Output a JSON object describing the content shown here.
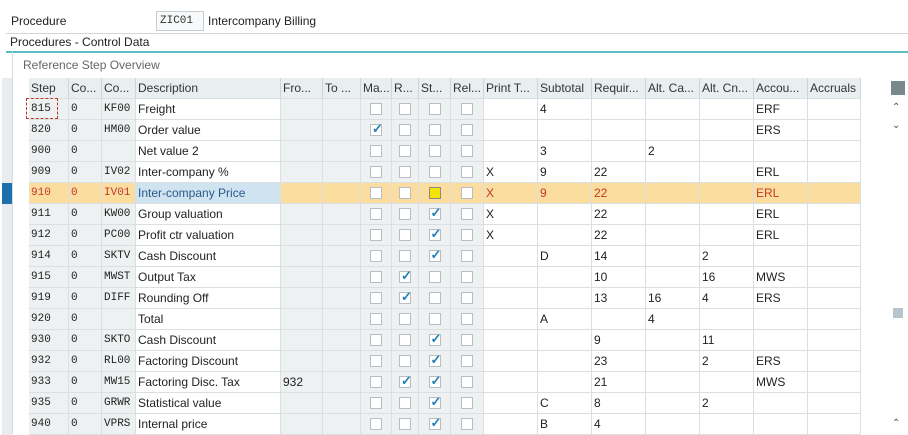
{
  "header": {
    "procedure_label": "Procedure",
    "procedure_code": "ZIC01",
    "procedure_name": "Intercompany Billing"
  },
  "group_title": "Procedures - Control Data",
  "panel_title": "Reference Step Overview",
  "columns": [
    "Step",
    "Co...",
    "Co...",
    "Description",
    "Fro...",
    "To ...",
    "Ma...",
    "R...",
    "St...",
    "Rel...",
    "Print T...",
    "Subtotal",
    "Requir...",
    "Alt. Ca...",
    "Alt. Cn...",
    "Accou...",
    "Accruals"
  ],
  "rows": [
    {
      "step": "815",
      "cnt": "0",
      "cond": "KF00",
      "desc": "Freight",
      "from": "",
      "to": "",
      "man": false,
      "req": false,
      "stat": false,
      "rel": false,
      "print": "",
      "sub": "4",
      "reqm": "",
      "altcalc": "",
      "altbase": "",
      "acct": "ERF",
      "accr": ""
    },
    {
      "step": "820",
      "cnt": "0",
      "cond": "HM00",
      "desc": "Order value",
      "from": "",
      "to": "",
      "man": true,
      "req": false,
      "stat": false,
      "rel": false,
      "print": "",
      "sub": "",
      "reqm": "",
      "altcalc": "",
      "altbase": "",
      "acct": "ERS",
      "accr": ""
    },
    {
      "step": "900",
      "cnt": "0",
      "cond": "",
      "desc": "Net value 2",
      "from": "",
      "to": "",
      "man": false,
      "req": false,
      "stat": false,
      "rel": false,
      "print": "",
      "sub": "3",
      "reqm": "",
      "altcalc": "2",
      "altbase": "",
      "acct": "",
      "accr": ""
    },
    {
      "step": "909",
      "cnt": "0",
      "cond": "IV02",
      "desc": "Inter-company %",
      "from": "",
      "to": "",
      "man": false,
      "req": false,
      "stat": false,
      "rel": false,
      "print": "X",
      "sub": "9",
      "reqm": "22",
      "altcalc": "",
      "altbase": "",
      "acct": "ERL",
      "accr": ""
    },
    {
      "step": "910",
      "cnt": "0",
      "cond": "IV01",
      "desc": "Inter-company Price",
      "from": "",
      "to": "",
      "man": false,
      "req": false,
      "stat": false,
      "rel": false,
      "print": "X",
      "sub": "9",
      "reqm": "22",
      "altcalc": "",
      "altbase": "",
      "acct": "ERL",
      "accr": ""
    },
    {
      "step": "911",
      "cnt": "0",
      "cond": "KW00",
      "desc": "Group valuation",
      "from": "",
      "to": "",
      "man": false,
      "req": false,
      "stat": true,
      "rel": false,
      "print": "X",
      "sub": "",
      "reqm": "22",
      "altcalc": "",
      "altbase": "",
      "acct": "ERL",
      "accr": ""
    },
    {
      "step": "912",
      "cnt": "0",
      "cond": "PC00",
      "desc": "Profit ctr valuation",
      "from": "",
      "to": "",
      "man": false,
      "req": false,
      "stat": true,
      "rel": false,
      "print": "X",
      "sub": "",
      "reqm": "22",
      "altcalc": "",
      "altbase": "",
      "acct": "ERL",
      "accr": ""
    },
    {
      "step": "914",
      "cnt": "0",
      "cond": "SKTV",
      "desc": "Cash Discount",
      "from": "",
      "to": "",
      "man": false,
      "req": false,
      "stat": true,
      "rel": false,
      "print": "",
      "sub": "D",
      "reqm": "14",
      "altcalc": "",
      "altbase": "2",
      "acct": "",
      "accr": ""
    },
    {
      "step": "915",
      "cnt": "0",
      "cond": "MWST",
      "desc": "Output Tax",
      "from": "",
      "to": "",
      "man": false,
      "req": true,
      "stat": false,
      "rel": false,
      "print": "",
      "sub": "",
      "reqm": "10",
      "altcalc": "",
      "altbase": "16",
      "acct": "MWS",
      "accr": ""
    },
    {
      "step": "919",
      "cnt": "0",
      "cond": "DIFF",
      "desc": "Rounding Off",
      "from": "",
      "to": "",
      "man": false,
      "req": true,
      "stat": false,
      "rel": false,
      "print": "",
      "sub": "",
      "reqm": "13",
      "altcalc": "16",
      "altbase": "4",
      "acct": "ERS",
      "accr": ""
    },
    {
      "step": "920",
      "cnt": "0",
      "cond": "",
      "desc": "Total",
      "from": "",
      "to": "",
      "man": false,
      "req": false,
      "stat": false,
      "rel": false,
      "print": "",
      "sub": "A",
      "reqm": "",
      "altcalc": "4",
      "altbase": "",
      "acct": "",
      "accr": ""
    },
    {
      "step": "930",
      "cnt": "0",
      "cond": "SKTO",
      "desc": "Cash Discount",
      "from": "",
      "to": "",
      "man": false,
      "req": false,
      "stat": true,
      "rel": false,
      "print": "",
      "sub": "",
      "reqm": "9",
      "altcalc": "",
      "altbase": "11",
      "acct": "",
      "accr": ""
    },
    {
      "step": "932",
      "cnt": "0",
      "cond": "RL00",
      "desc": "Factoring Discount",
      "from": "",
      "to": "",
      "man": false,
      "req": false,
      "stat": true,
      "rel": false,
      "print": "",
      "sub": "",
      "reqm": "23",
      "altcalc": "",
      "altbase": "2",
      "acct": "ERS",
      "accr": ""
    },
    {
      "step": "933",
      "cnt": "0",
      "cond": "MW15",
      "desc": "Factoring Disc. Tax",
      "from": "932",
      "to": "",
      "man": false,
      "req": true,
      "stat": true,
      "rel": false,
      "print": "",
      "sub": "",
      "reqm": "21",
      "altcalc": "",
      "altbase": "",
      "acct": "MWS",
      "accr": ""
    },
    {
      "step": "935",
      "cnt": "0",
      "cond": "GRWR",
      "desc": "Statistical value",
      "from": "",
      "to": "",
      "man": false,
      "req": false,
      "stat": true,
      "rel": false,
      "print": "",
      "sub": "C",
      "reqm": "8",
      "altcalc": "",
      "altbase": "2",
      "acct": "",
      "accr": ""
    },
    {
      "step": "940",
      "cnt": "0",
      "cond": "VPRS",
      "desc": "Internal price",
      "from": "",
      "to": "",
      "man": false,
      "req": false,
      "stat": true,
      "rel": false,
      "print": "",
      "sub": "B",
      "reqm": "4",
      "altcalc": "",
      "altbase": "",
      "acct": "",
      "accr": ""
    }
  ],
  "selected_row": 4,
  "icons": {
    "settings": "table-settings-icon",
    "up": "scroll-up-icon",
    "down": "scroll-down-icon"
  }
}
